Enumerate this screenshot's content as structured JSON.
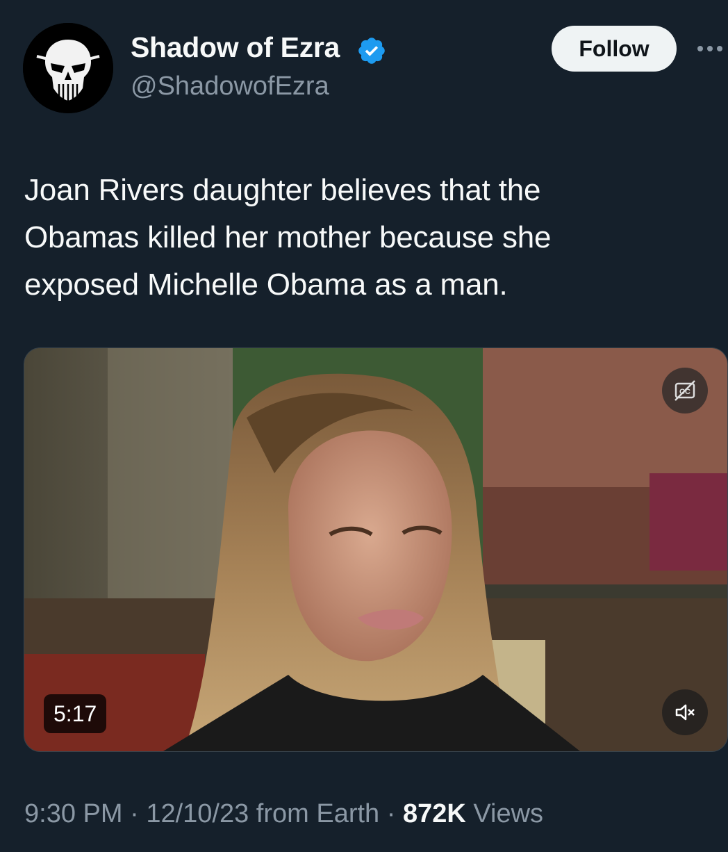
{
  "author": {
    "display_name": "Shadow of Ezra",
    "handle": "@ShadowofEzra",
    "verified": true,
    "avatar_icon": "punisher-skull-icon"
  },
  "actions": {
    "follow_label": "Follow",
    "more_icon": "more-horizontal-icon"
  },
  "tweet": {
    "text_lines": [
      "Joan Rivers daughter believes that the",
      "Obamas killed her mother because she",
      "exposed Michelle Obama as a man."
    ]
  },
  "media": {
    "type": "video",
    "duration": "5:17",
    "cc_icon": "closed-captions-off-icon",
    "mute_icon": "speaker-muted-icon"
  },
  "meta": {
    "time": "9:30 PM",
    "separator": "·",
    "date": "12/10/23",
    "source": "from Earth",
    "views_count": "872K",
    "views_label": "Views"
  },
  "colors": {
    "background": "#15202b",
    "verified": "#1d9bf0",
    "secondary_text": "#8b98a5",
    "follow_button_bg": "#eff3f4"
  }
}
